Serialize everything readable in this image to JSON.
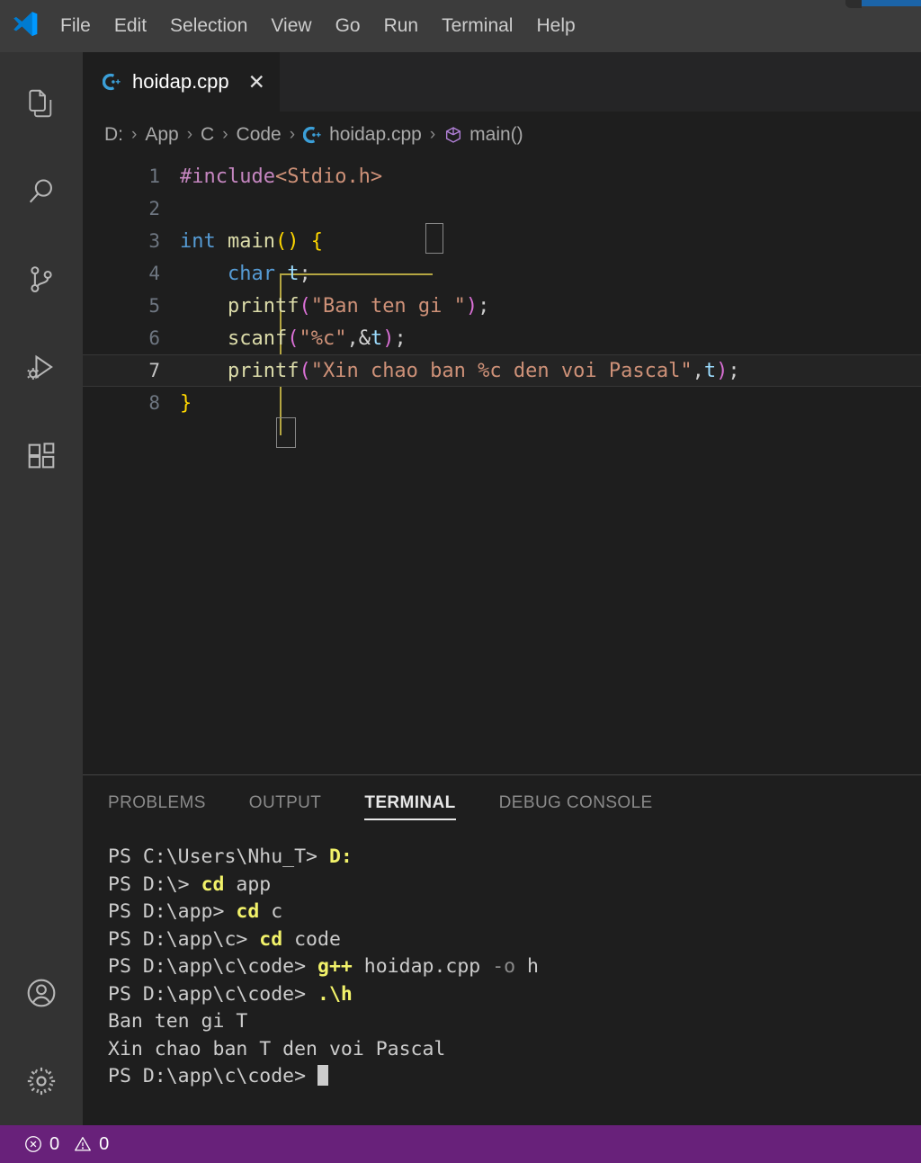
{
  "window": {
    "logo": "vscode-logo",
    "menu": [
      "File",
      "Edit",
      "Selection",
      "View",
      "Go",
      "Run",
      "Terminal",
      "Help"
    ]
  },
  "activitybar": {
    "top_items": [
      {
        "name": "explorer",
        "icon": "files-icon"
      },
      {
        "name": "search",
        "icon": "search-icon"
      },
      {
        "name": "source-control",
        "icon": "source-control-icon"
      },
      {
        "name": "run-and-debug",
        "icon": "run-debug-icon"
      },
      {
        "name": "extensions",
        "icon": "extensions-icon"
      }
    ],
    "bottom_items": [
      {
        "name": "accounts",
        "icon": "account-icon"
      },
      {
        "name": "manage",
        "icon": "gear-icon"
      }
    ]
  },
  "tabs": [
    {
      "label": "hoidap.cpp",
      "icon": "cpp-file-icon",
      "close": "✕",
      "active": true
    }
  ],
  "breadcrumbs": {
    "separator": "›",
    "items": [
      "D:",
      "App",
      "C",
      "Code",
      "hoidap.cpp",
      "main()"
    ],
    "file_icon": "cpp-file-icon",
    "symbol_icon": "symbol-method-icon"
  },
  "editor": {
    "active_line": 7,
    "lines": [
      {
        "n": "1",
        "tokens": [
          {
            "t": "#include",
            "c": "c-pre"
          },
          {
            "t": "<Stdio.h>",
            "c": "c-str"
          }
        ],
        "indent": 0
      },
      {
        "n": "2",
        "tokens": [],
        "indent": 0
      },
      {
        "n": "3",
        "tokens": [
          {
            "t": "int",
            "c": "c-kw"
          },
          {
            "t": " ",
            "c": "c-pun"
          },
          {
            "t": "main",
            "c": "c-fn"
          },
          {
            "t": "()",
            "c": "c-br1"
          },
          {
            "t": " ",
            "c": "c-pun"
          },
          {
            "t": "{",
            "c": "c-br1"
          }
        ],
        "indent": 0
      },
      {
        "n": "4",
        "tokens": [
          {
            "t": "char",
            "c": "c-kw"
          },
          {
            "t": " ",
            "c": "c-pun"
          },
          {
            "t": "t",
            "c": "c-var"
          },
          {
            "t": ";",
            "c": "c-pun"
          }
        ],
        "indent": 1
      },
      {
        "n": "5",
        "tokens": [
          {
            "t": "printf",
            "c": "c-fn"
          },
          {
            "t": "(",
            "c": "c-br2"
          },
          {
            "t": "\"Ban ten gi \"",
            "c": "c-str"
          },
          {
            "t": ")",
            "c": "c-br2"
          },
          {
            "t": ";",
            "c": "c-pun"
          }
        ],
        "indent": 1
      },
      {
        "n": "6",
        "tokens": [
          {
            "t": "scanf",
            "c": "c-fn"
          },
          {
            "t": "(",
            "c": "c-br2"
          },
          {
            "t": "\"%c\"",
            "c": "c-str"
          },
          {
            "t": ",",
            "c": "c-pun"
          },
          {
            "t": "&",
            "c": "c-amp"
          },
          {
            "t": "t",
            "c": "c-var"
          },
          {
            "t": ")",
            "c": "c-br2"
          },
          {
            "t": ";",
            "c": "c-pun"
          }
        ],
        "indent": 1
      },
      {
        "n": "7",
        "tokens": [
          {
            "t": "printf",
            "c": "c-fn"
          },
          {
            "t": "(",
            "c": "c-br2"
          },
          {
            "t": "\"Xin chao ban %c den voi Pascal\"",
            "c": "c-str"
          },
          {
            "t": ",",
            "c": "c-pun"
          },
          {
            "t": "t",
            "c": "c-var"
          },
          {
            "t": ")",
            "c": "c-br2"
          },
          {
            "t": ";",
            "c": "c-pun"
          }
        ],
        "indent": 1
      },
      {
        "n": "8",
        "tokens": [
          {
            "t": "}",
            "c": "c-br1"
          }
        ],
        "indent": 0
      }
    ]
  },
  "panel": {
    "tabs": [
      "PROBLEMS",
      "OUTPUT",
      "TERMINAL",
      "DEBUG CONSOLE"
    ],
    "active_tab": "TERMINAL",
    "terminal_lines": [
      [
        {
          "t": "PS C:\\Users\\Nhu_T> ",
          "c": ""
        },
        {
          "t": "D:",
          "c": "t-cmd"
        }
      ],
      [
        {
          "t": "PS D:\\> ",
          "c": ""
        },
        {
          "t": "cd",
          "c": "t-cmd"
        },
        {
          "t": " app",
          "c": ""
        }
      ],
      [
        {
          "t": "PS D:\\app> ",
          "c": ""
        },
        {
          "t": "cd",
          "c": "t-cmd"
        },
        {
          "t": " c",
          "c": ""
        }
      ],
      [
        {
          "t": "PS D:\\app\\c> ",
          "c": ""
        },
        {
          "t": "cd",
          "c": "t-cmd"
        },
        {
          "t": " code",
          "c": ""
        }
      ],
      [
        {
          "t": "PS D:\\app\\c\\code> ",
          "c": ""
        },
        {
          "t": "g++",
          "c": "t-cmd"
        },
        {
          "t": " hoidap.cpp ",
          "c": ""
        },
        {
          "t": "-o",
          "c": "t-dim"
        },
        {
          "t": " h",
          "c": ""
        }
      ],
      [
        {
          "t": "PS D:\\app\\c\\code> ",
          "c": ""
        },
        {
          "t": ".\\h",
          "c": "t-cmd"
        }
      ],
      [
        {
          "t": "Ban ten gi T",
          "c": ""
        }
      ],
      [
        {
          "t": "Xin chao ban T den voi Pascal",
          "c": ""
        }
      ],
      [
        {
          "t": "PS D:\\app\\c\\code> ",
          "c": ""
        },
        {
          "t": "",
          "c": "cursor"
        }
      ]
    ]
  },
  "statusbar": {
    "background": "#68217a",
    "errors": {
      "icon": "error-icon",
      "count": "0"
    },
    "warnings": {
      "icon": "warning-icon",
      "count": "0"
    }
  }
}
